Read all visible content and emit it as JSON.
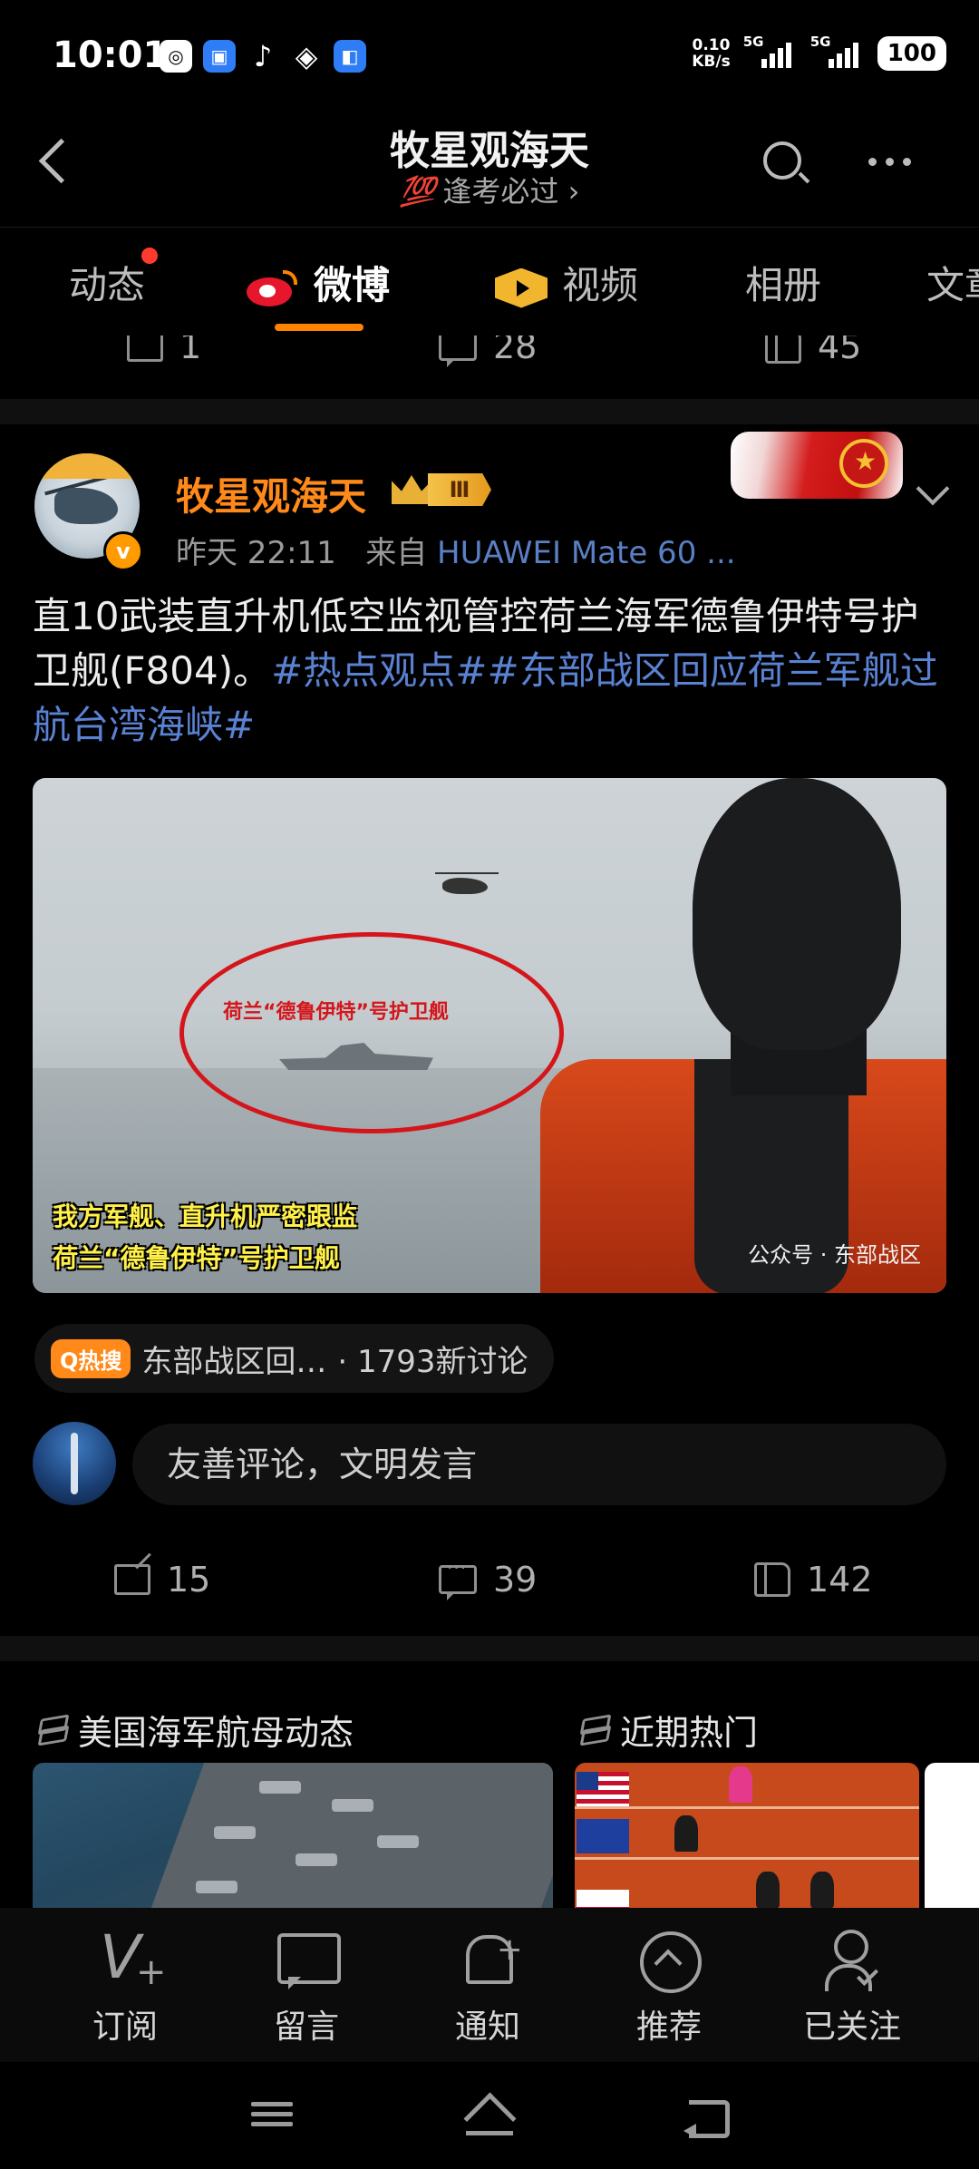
{
  "status_bar": {
    "time": "10:01",
    "net_speed_value": "0.10",
    "net_speed_unit": "KB/s",
    "sim1": "5G",
    "sim2": "5G",
    "battery": "100"
  },
  "header": {
    "title": "牧星观海天",
    "subtitle_badge": "💯",
    "subtitle": "逢考必过 ›"
  },
  "tabs": [
    {
      "label": "动态",
      "has_dot": true
    },
    {
      "label": "微博",
      "active": true
    },
    {
      "label": "视频"
    },
    {
      "label": "相册"
    },
    {
      "label": "文章"
    }
  ],
  "prev_post_stats": {
    "reposts": "1",
    "comments": "28",
    "likes": "45"
  },
  "post": {
    "author": "牧星观海天",
    "level": "Ⅲ",
    "verified_mark": "v",
    "time": "昨天 22:11",
    "source_prefix": "来自",
    "device": "HUAWEI Mate 60 ...",
    "text_main": "直10武装直升机低空监视管控荷兰海军德鲁伊特号护卫舰(F804)。",
    "tag1": "#热点观点#",
    "tag2": "#东部战区回应荷兰军舰过航台湾海峡#",
    "image": {
      "circle_label": "荷兰“德鲁伊特”号护卫舰",
      "caption_line1": "我方军舰、直升机严密跟监",
      "caption_line2": "荷兰“德鲁伊特”号护卫舰",
      "watermark": "公众号 · 东部战区"
    },
    "hot_badge": "Q热搜",
    "hot_topic": "东部战区回…",
    "hot_count": "· 1793新讨论",
    "comment_placeholder": "友善评论，文明发言",
    "stats": {
      "reposts": "15",
      "comments": "39",
      "likes": "142"
    }
  },
  "topics": [
    {
      "title": "美国海军航母动态"
    },
    {
      "title": "近期热门"
    }
  ],
  "bottom_nav": [
    {
      "label": "订阅"
    },
    {
      "label": "留言"
    },
    {
      "label": "通知"
    },
    {
      "label": "推荐"
    },
    {
      "label": "已关注"
    }
  ],
  "colors": {
    "accent_orange": "#ff8200",
    "link_blue": "#5a82d2",
    "background": "#000000"
  }
}
